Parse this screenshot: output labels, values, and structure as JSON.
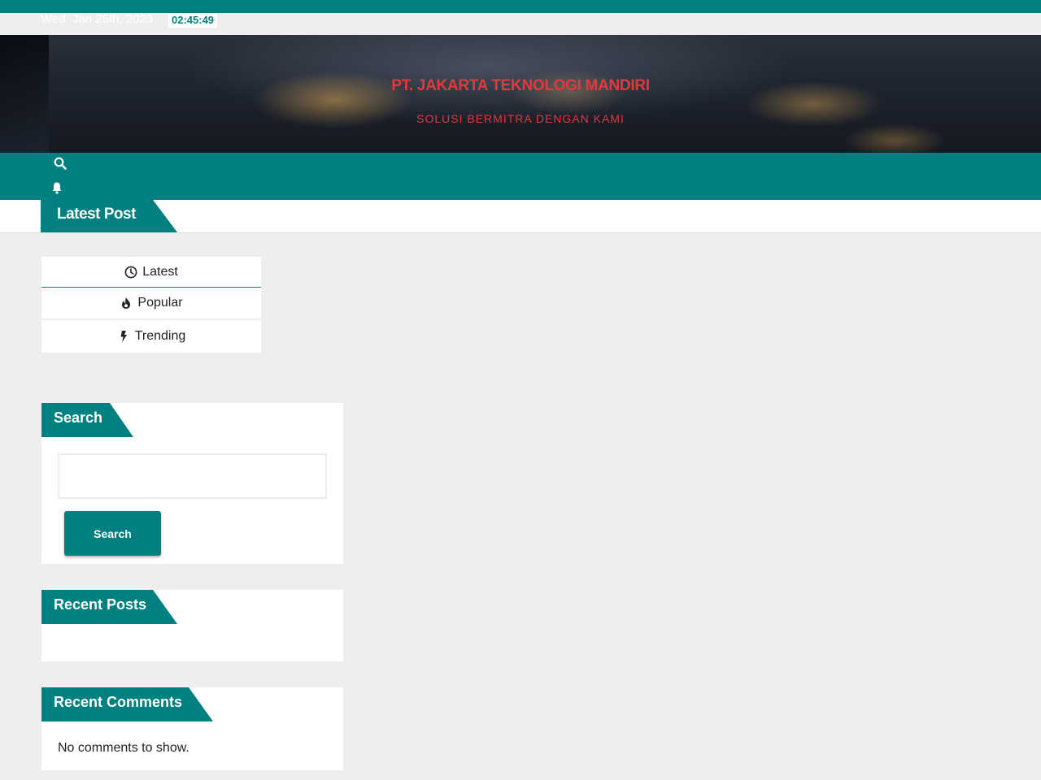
{
  "topbar": {
    "date": "Wed. Jan 25th, 2023",
    "time": "02:45:49"
  },
  "hero": {
    "site_title": "PT. JAKARTA TEKNOLOGI MANDIRI",
    "tagline": "SOLUSI BERMITRA DENGAN KAMI"
  },
  "nav": {
    "icons": [
      "search-icon",
      "bell-icon"
    ]
  },
  "latest_bar": {
    "label": "Latest Post"
  },
  "tabs": [
    {
      "label": "Latest",
      "icon": "clock-icon"
    },
    {
      "label": "Popular",
      "icon": "fire-icon"
    },
    {
      "label": "Trending",
      "icon": "bolt-icon"
    }
  ],
  "widgets": {
    "search": {
      "title": "Search",
      "input_value": "",
      "button_label": "Search"
    },
    "recent_posts": {
      "title": "Recent Posts"
    },
    "recent_comments": {
      "title": "Recent Comments",
      "empty_text": "No comments to show."
    }
  },
  "colors": {
    "brand": "#008080",
    "title_red": "#e0393e",
    "page_bg": "#eeeeee"
  }
}
